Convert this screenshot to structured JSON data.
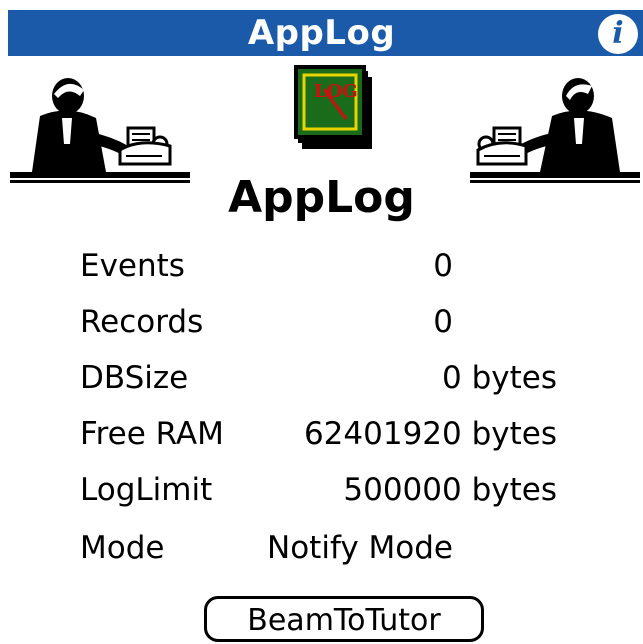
{
  "titlebar": {
    "title": "AppLog",
    "info_icon": "info-icon"
  },
  "header": {
    "app_name": "AppLog",
    "logo_text": "LOG",
    "logo_icon": "book-icon"
  },
  "stats": [
    {
      "label": "Events",
      "value": "0"
    },
    {
      "label": "Records",
      "value": "0"
    },
    {
      "label": "DBSize",
      "value": "0 bytes"
    },
    {
      "label": "Free RAM",
      "value": "62401920 bytes"
    },
    {
      "label": "LogLimit",
      "value": "500000 bytes"
    },
    {
      "label": "Mode",
      "value": "Notify Mode"
    }
  ],
  "actions": {
    "beam_label": "BeamToTutor"
  },
  "colors": {
    "titlebar": "#1a5aa8",
    "logo_bg": "#1a6b1a",
    "logo_frame": "#e8d400",
    "logo_text": "#cc1010"
  }
}
